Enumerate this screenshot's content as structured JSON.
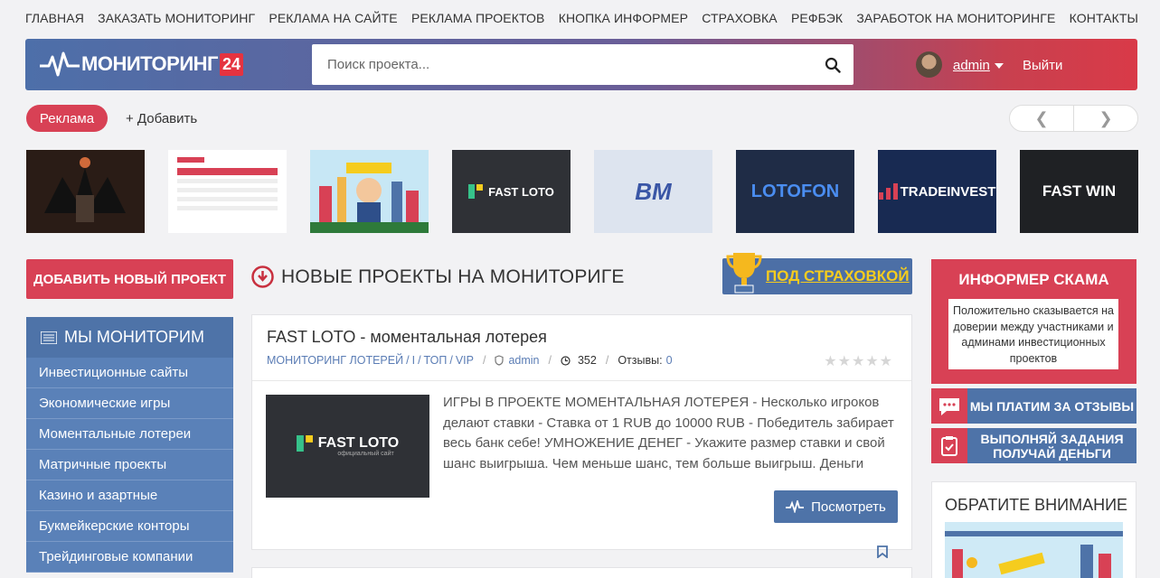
{
  "topnav": [
    "ГЛАВНАЯ",
    "ЗАКАЗАТЬ МОНИТОРИНГ",
    "РЕКЛАМА НА САЙТЕ",
    "РЕКЛАМА ПРОЕКТОВ",
    "КНОПКА ИНФОРМЕР",
    "СТРАХОВКА",
    "РЕФБЭК",
    "ЗАРАБОТОК НА МОНИТОРИНГЕ",
    "КОНТАКТЫ"
  ],
  "header": {
    "logo_text": "МОНИТОРИНГ",
    "logo_badge": "24",
    "search_placeholder": "Поиск проекта...",
    "user": "admin",
    "logout": "Выйти"
  },
  "ads": {
    "tag": "Реклама",
    "add": "+ Добавить",
    "banners": [
      {
        "icon": "game-of-thrones-banner"
      },
      {
        "icon": "investment-table-banner"
      },
      {
        "icon": "city-mascot-banner"
      },
      {
        "text": "FAST LOTO"
      },
      {
        "text": "BM"
      },
      {
        "text": "LOTOFON"
      },
      {
        "text": "TRADEINVEST"
      },
      {
        "text": "FAST WIN"
      }
    ]
  },
  "sidebar": {
    "add_button": "ДОБАВИТЬ НОВЫЙ ПРОЕКТ",
    "monitor_title": "МЫ МОНИТОРИМ",
    "items": [
      "Инвестиционные сайты",
      "Экономические игры",
      "Моментальные лотереи",
      "Матричные проекты",
      "Казино и азартные",
      "Букмейкерские конторы",
      "Трейдинговые компании"
    ]
  },
  "main": {
    "section_title": "НОВЫЕ ПРОЕКТЫ НА МОНИТОРИГЕ",
    "insured_label": "ПОД СТРАХОВКОЙ",
    "card": {
      "title": "FAST LOTO - моментальная лотерея",
      "cat1": "МОНИТОРИНГ ЛОТЕРЕЙ",
      "cat2": "I",
      "cat3": "ТОП",
      "cat4": "VIP",
      "author": "admin",
      "views": "352",
      "reviews_label": "Отзывы:",
      "reviews_count": "0",
      "thumb_text": "FAST LOTO",
      "thumb_sub": "официальный сайт",
      "description": "ИГРЫ В ПРОЕКТЕ МОМЕНТАЛЬНАЯ ЛОТЕРЕЯ - Несколько игроков делают ставки - Ставка от 1 RUB до 10000 RUB - Победитель забирает весь банк себе! УМНОЖЕНИЕ ДЕНЕГ - Укажите размер ставки и свой шанс выигрыша. Чем меньше шанс, тем больше выигрыш. Деньги",
      "view_button": "Посмотреть"
    }
  },
  "right": {
    "scam_title": "ИНФОРМЕР СКАМА",
    "scam_text": "Положительно сказывается на доверии между участниками и админами инвестиционных проектов",
    "pay_reviews": "МЫ ПЛАТИМ ЗА ОТЗЫВЫ",
    "tasks": "ВЫПОЛНЯЙ ЗАДАНИЯ ПОЛУЧАЙ ДЕНЬГИ",
    "attention": "ОБРАТИТЕ ВНИМАНИЕ"
  },
  "colors": {
    "accent_red": "#d84155",
    "accent_blue": "#4e73a8",
    "gold": "#f5cc1e"
  }
}
